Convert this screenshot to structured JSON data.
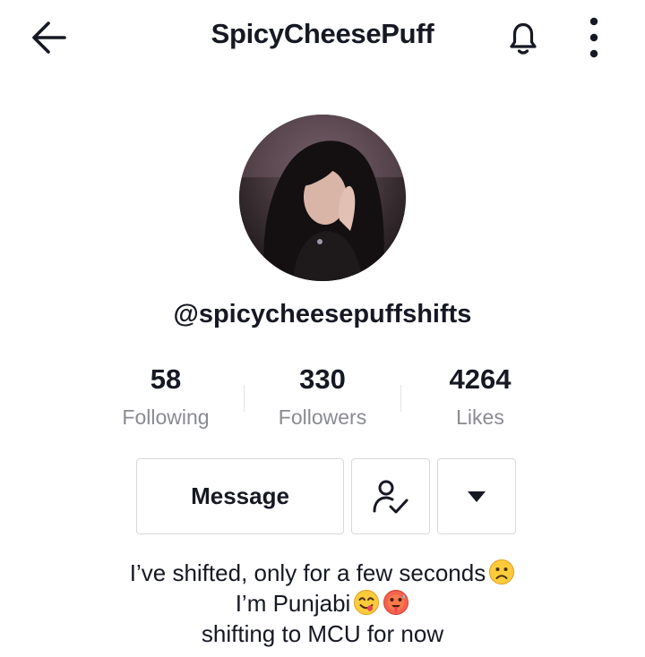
{
  "header": {
    "title": "SpicyCheesePuff",
    "icons": [
      "back-arrow-icon",
      "bell-icon",
      "more-vertical-icon"
    ]
  },
  "profile": {
    "username": "@spicycheesepuffshifts",
    "avatar": "profile-photo"
  },
  "stats": [
    {
      "value": "58",
      "label": "Following"
    },
    {
      "value": "330",
      "label": "Followers"
    },
    {
      "value": "4264",
      "label": "Likes"
    }
  ],
  "actions": {
    "message_label": "Message",
    "friend_icon": "user-check-icon",
    "dropdown_icon": "caret-down-icon"
  },
  "bio": {
    "line1": "I’ve shifted, only for a few seconds",
    "line2": "I’m Punjabi",
    "line3": "shifting to MCU for now",
    "emojis": [
      "frowning-face",
      "face-savoring-food",
      "hot-face"
    ]
  },
  "colors": {
    "text": "#161823",
    "secondary_text": "#8a8b91",
    "border": "#d9d9db"
  }
}
